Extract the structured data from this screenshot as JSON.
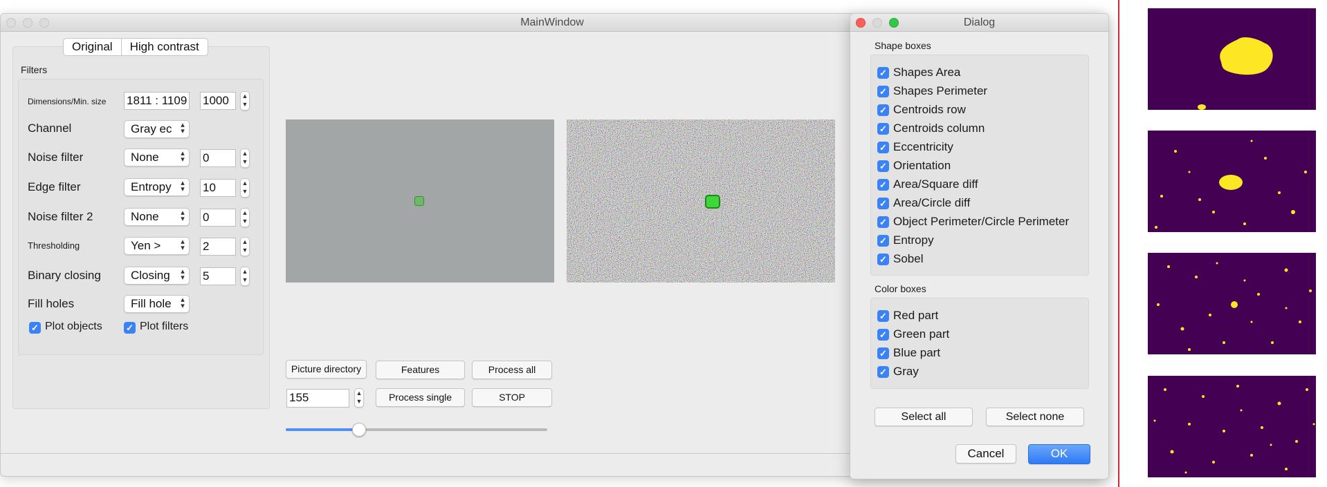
{
  "main_window": {
    "title": "MainWindow",
    "tabs": [
      "Original",
      "High contrast"
    ],
    "filters_title": "Filters",
    "rows": {
      "dimensions": {
        "label": "Dimensions/Min. size",
        "value": "1811 : 1109",
        "min_size": "1000"
      },
      "channel": {
        "label": "Channel",
        "value": "Gray ec"
      },
      "noise_filter": {
        "label": "Noise filter",
        "value": "None",
        "param": "0"
      },
      "edge_filter": {
        "label": "Edge filter",
        "value": "Entropy",
        "param": "10"
      },
      "noise_filter_2": {
        "label": "Noise filter 2",
        "value": "None",
        "param": "0"
      },
      "thresholding": {
        "label": "Thresholding",
        "value": "Yen >",
        "param": "2"
      },
      "binary_closing": {
        "label": "Binary closing",
        "value": "Closing",
        "param": "5"
      },
      "fill_holes": {
        "label": "Fill holes",
        "value": "Fill hole"
      }
    },
    "plot_objects": "Plot objects",
    "plot_filters": "Plot filters",
    "buttons": {
      "picture_directory": "Picture directory",
      "features": "Features",
      "process_all": "Process all",
      "process_single": "Process single",
      "stop": "STOP"
    },
    "image_index": "155",
    "slider_fraction": 0.28
  },
  "dialog": {
    "title": "Dialog",
    "shape_boxes_title": "Shape boxes",
    "shape_boxes": [
      "Shapes Area",
      "Shapes Perimeter",
      "Centroids row",
      "Centroids column",
      "Eccentricity",
      "Orientation",
      "Area/Square diff",
      "Area/Circle diff",
      "Object Perimeter/Circle Perimeter",
      "Entropy",
      "Sobel"
    ],
    "color_boxes_title": "Color boxes",
    "color_boxes": [
      "Red part",
      "Green part",
      "Blue part",
      "Gray"
    ],
    "select_all": "Select all",
    "select_none": "Select none",
    "cancel": "Cancel",
    "ok": "OK"
  },
  "colors": {
    "accent": "#3b82f6",
    "thumb_background": "#440154",
    "thumb_foreground": "#fde725",
    "separator": "#d0283a"
  }
}
